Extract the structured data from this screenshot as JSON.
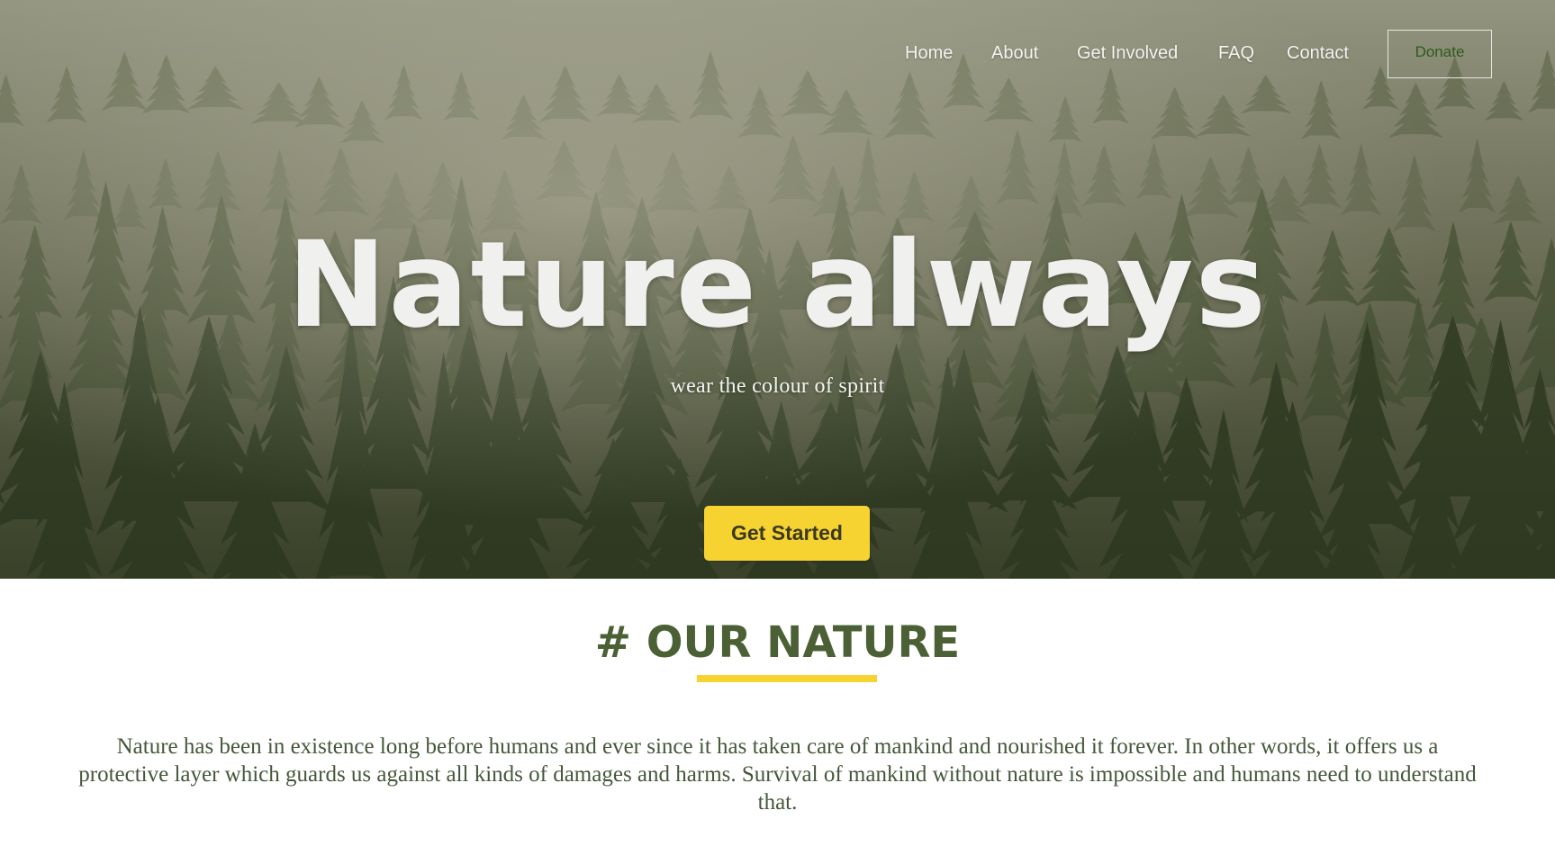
{
  "nav": {
    "links": [
      "Home",
      "About",
      "Get Involved",
      "FAQ",
      "Contact"
    ],
    "donate_label": "Donate"
  },
  "hero": {
    "title": "Nature always",
    "subtitle": "wear the colour of spirit",
    "cta_label": "Get Started"
  },
  "section": {
    "title": "# OUR NATURE",
    "body": "Nature has been in existence long before humans and ever since it has taken care of mankind and nourished it forever. In other words, it offers us a protective layer which guards us against all kinds of damages and harms. Survival of mankind without nature is impossible and humans need to understand that."
  },
  "colors": {
    "accent_yellow": "#f7d332",
    "heading_green": "#4b6035",
    "body_green": "#44583a"
  }
}
